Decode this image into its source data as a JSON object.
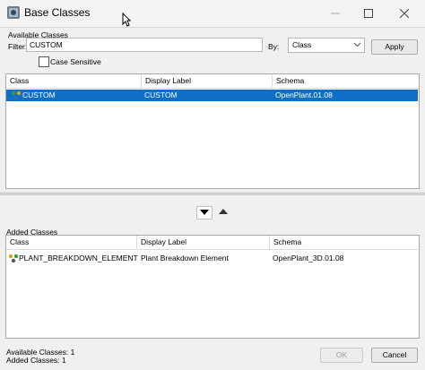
{
  "window": {
    "title": "Base Classes"
  },
  "available": {
    "section_label": "Available Classes",
    "filter_label": "Filter:",
    "filter_value": "CUSTOM",
    "by_label": "By:",
    "by_value": "Class",
    "apply_label": "Apply",
    "case_sensitive_label": "Case Sensitive",
    "columns": [
      "Class",
      "Display Label",
      "Schema"
    ],
    "rows": [
      {
        "class": "CUSTOM",
        "display_label": "CUSTOM",
        "schema": "OpenPlant.01.08",
        "selected": true
      }
    ]
  },
  "added": {
    "section_label": "Added Classes",
    "columns": [
      "Class",
      "Display Label",
      "Schema"
    ],
    "rows": [
      {
        "class": "PLANT_BREAKDOWN_ELEMENT",
        "display_label": "Plant Breakdown Element",
        "schema": "OpenPlant_3D.01.08"
      }
    ]
  },
  "footer": {
    "available_count": "Available Classes: 1",
    "added_count": "Added Classes: 1",
    "ok_label": "OK",
    "cancel_label": "Cancel"
  },
  "icons": [
    "app-icon",
    "minimize-icon",
    "maximize-icon",
    "close-icon",
    "chevron-down-icon",
    "class-icon",
    "arrow-down-icon",
    "arrow-up-icon",
    "mouse-cursor-icon"
  ],
  "colors": {
    "selection": "#0f6fc6",
    "window_bg": "#f0f0f0"
  }
}
